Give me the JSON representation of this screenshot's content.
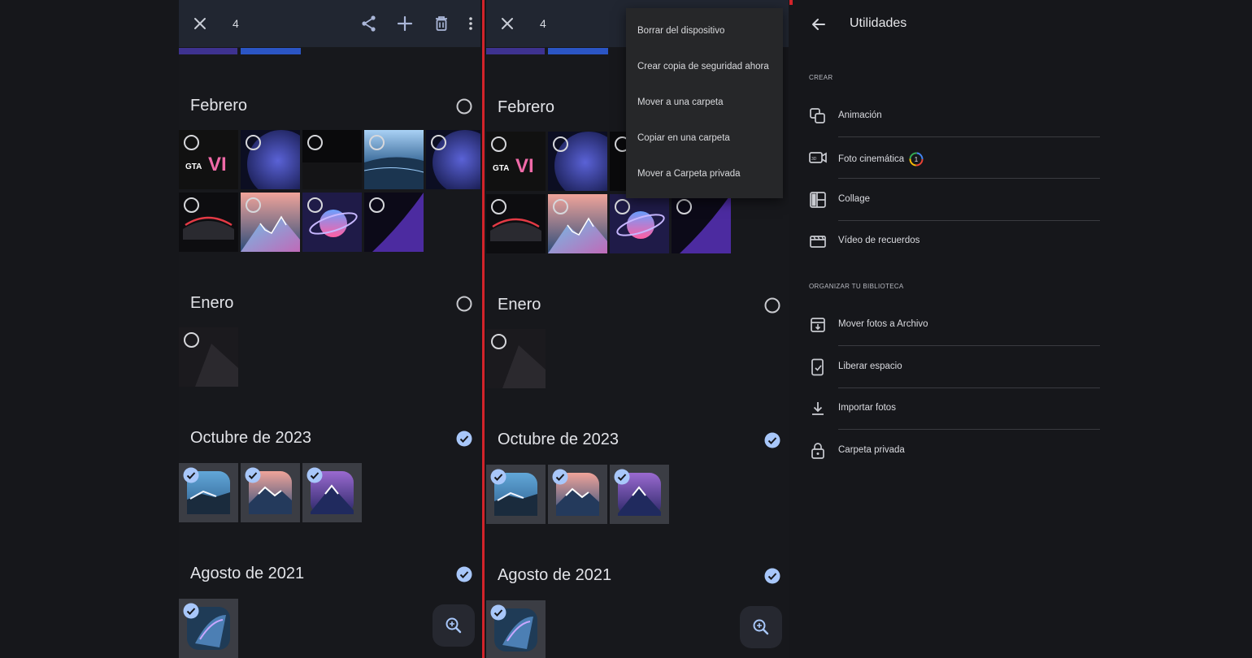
{
  "colors": {
    "accent": "#a8c7fa",
    "stripe_purple": "#3e3290",
    "stripe_blue": "#2b55c4",
    "divider": "#d2232a",
    "bar": "#212631"
  },
  "selection_bar": {
    "count": "4",
    "icons": [
      "close-icon",
      "share-icon",
      "add-icon",
      "delete-icon",
      "more-vert-icon"
    ]
  },
  "months": [
    {
      "title": "Febrero",
      "selected": false
    },
    {
      "title": "Enero",
      "selected": false
    },
    {
      "title": "Octubre de 2023",
      "selected": true
    },
    {
      "title": "Agosto de 2021",
      "selected": true
    }
  ],
  "overflow_menu": {
    "items": [
      "Borrar del dispositivo",
      "Crear copia de seguridad ahora",
      "Mover a una carpeta",
      "Copiar en una carpeta",
      "Mover a Carpeta privada"
    ]
  },
  "utilities": {
    "title": "Utilidades",
    "sections": [
      {
        "header": "Crear",
        "items": [
          {
            "label": "Animación",
            "icon": "animation-icon"
          },
          {
            "label": "Foto cinemática",
            "icon": "cinematic-icon",
            "badge": "1"
          },
          {
            "label": "Collage",
            "icon": "collage-icon"
          },
          {
            "label": "Vídeo de recuerdos",
            "icon": "movie-icon"
          }
        ]
      },
      {
        "header": "Organizar tu biblioteca",
        "items": [
          {
            "label": "Mover fotos a Archivo",
            "icon": "archive-icon"
          },
          {
            "label": "Liberar espacio",
            "icon": "free-space-icon"
          },
          {
            "label": "Importar fotos",
            "icon": "download-icon"
          },
          {
            "label": "Carpeta privada",
            "icon": "lock-icon"
          }
        ]
      }
    ]
  }
}
